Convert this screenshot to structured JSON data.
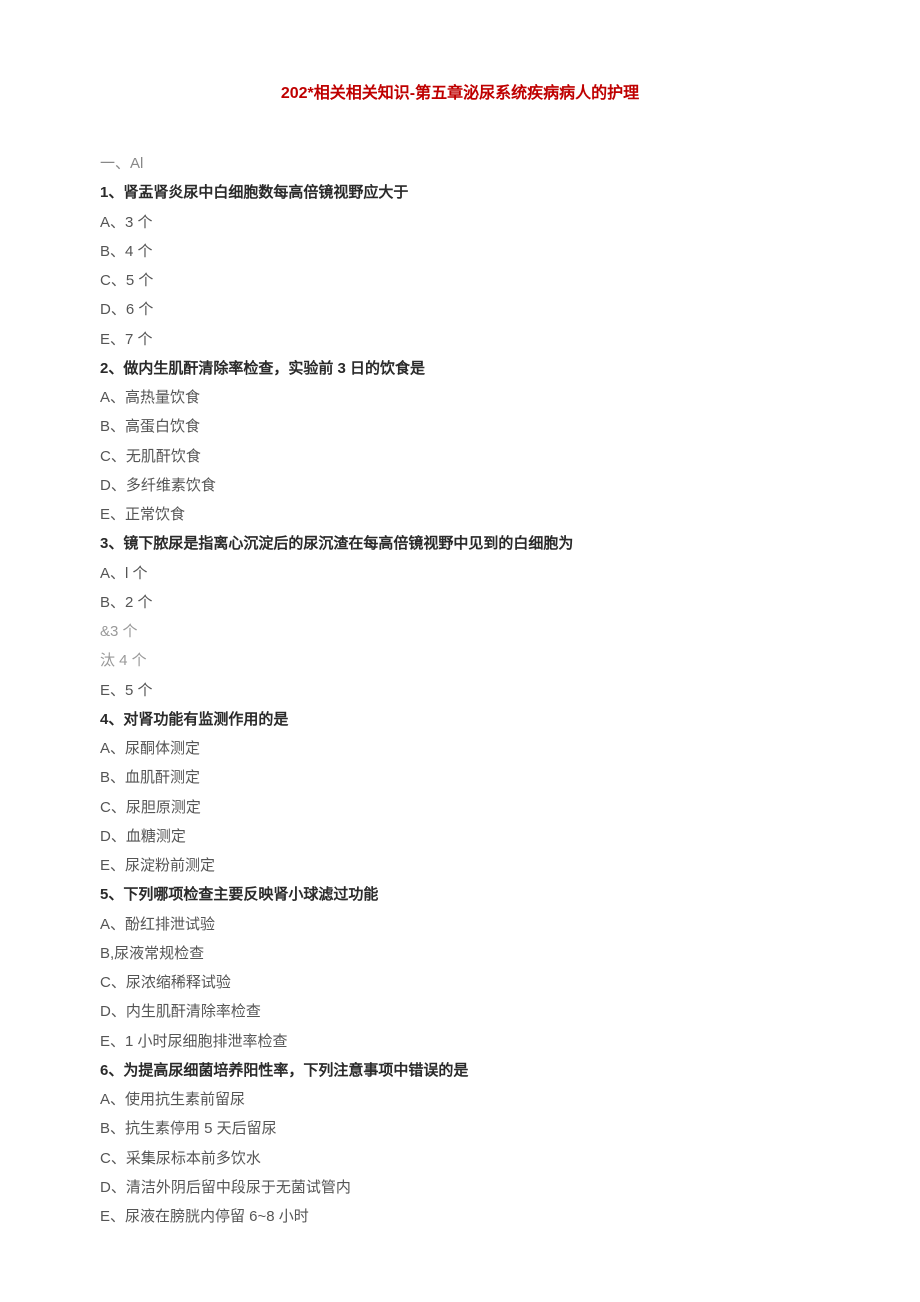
{
  "title": "202*相关相关知识-第五章泌尿系统疾病病人的护理",
  "section": "一、Al",
  "questions": [
    {
      "num": "1、",
      "stem": "肾盂肾炎尿中白细胞数每高倍镜视野应大于",
      "options": [
        {
          "label": "A、3 个"
        },
        {
          "label": "B、4 个"
        },
        {
          "label": "C、5 个"
        },
        {
          "label": "D、6 个"
        },
        {
          "label": "E、7 个"
        }
      ]
    },
    {
      "num": "2、",
      "stem": "做内生肌酐清除率检查，实验前 3 日的饮食是",
      "options": [
        {
          "label": "A、高热量饮食"
        },
        {
          "label": "B、高蛋白饮食"
        },
        {
          "label": "C、无肌酐饮食"
        },
        {
          "label": "D、多纤维素饮食"
        },
        {
          "label": "E、正常饮食"
        }
      ]
    },
    {
      "num": "3、",
      "stem": "镜下脓尿是指离心沉淀后的尿沉渣在每高倍镜视野中见到的白细胞为",
      "options": [
        {
          "label": "A、l 个"
        },
        {
          "label": "B、2 个"
        },
        {
          "label": "&3 个",
          "gray": true
        },
        {
          "label": "汰 4 个",
          "gray": true
        },
        {
          "label": "E、5 个"
        }
      ]
    },
    {
      "num": "4、",
      "stem": "对肾功能有监测作用的是",
      "options": [
        {
          "label": "A、尿酮体测定"
        },
        {
          "label": "B、血肌酐测定"
        },
        {
          "label": "C、尿胆原测定"
        },
        {
          "label": "D、血糖测定"
        },
        {
          "label": "E、尿淀粉前测定"
        }
      ]
    },
    {
      "num": "5、",
      "stem": "下列哪项检查主要反映肾小球滤过功能",
      "options": [
        {
          "label": "A、酚红排泄试验"
        },
        {
          "label": "B,尿液常规检查"
        },
        {
          "label": "C、尿浓缩稀释试验"
        },
        {
          "label": "D、内生肌酐清除率检查"
        },
        {
          "label": "E、1 小时尿细胞排泄率检查"
        }
      ]
    },
    {
      "num": "6、",
      "stem": "为提高尿细菌培养阳性率，下列注意事项中错误的是",
      "options": [
        {
          "label": "A、使用抗生素前留尿"
        },
        {
          "label": "B、抗生素停用 5 天后留尿"
        },
        {
          "label": "C、采集尿标本前多饮水"
        },
        {
          "label": "D、清洁外阴后留中段尿于无菌试管内"
        },
        {
          "label": "E、尿液在膀胱内停留 6~8 小时"
        }
      ]
    }
  ]
}
